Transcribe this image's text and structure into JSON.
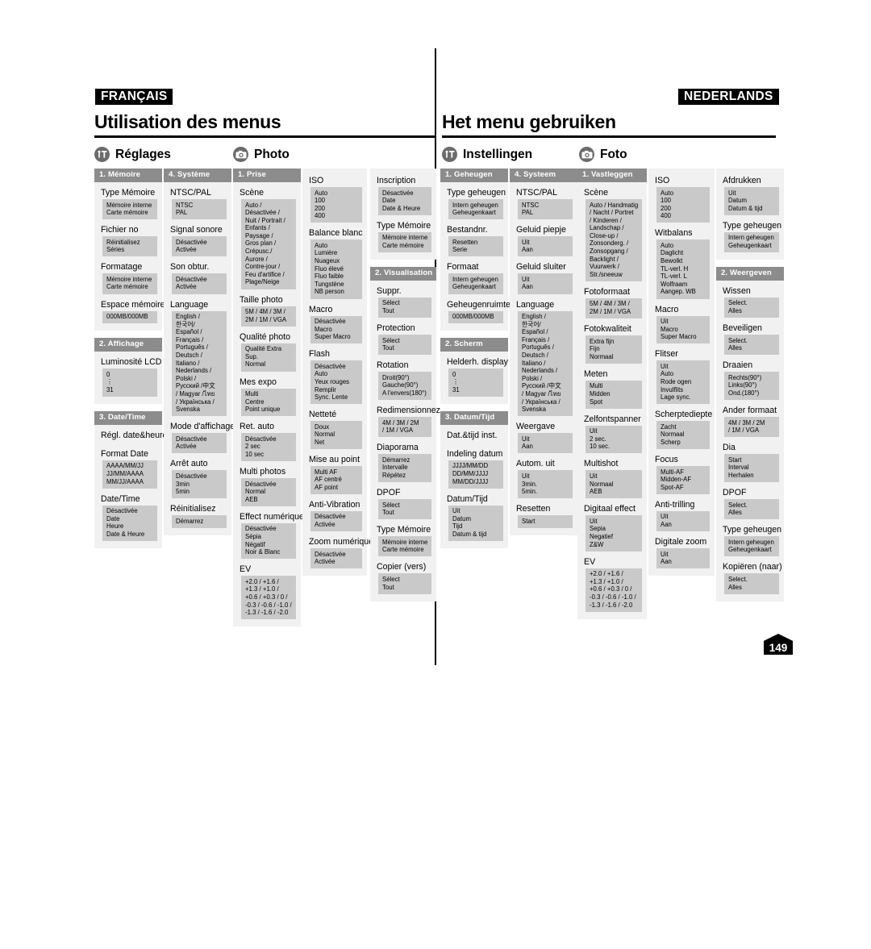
{
  "left": {
    "language_tag": "FRANÇAIS",
    "title": "Utilisation des menus",
    "sections": [
      {
        "icon": "settings-icon",
        "label": "Réglages"
      },
      {
        "icon": "camera-icon",
        "label": "Photo"
      }
    ],
    "columns": [
      {
        "groups": [
          {
            "head": "1. Mémoire",
            "items": [
              {
                "label": "Type Mémoire",
                "options": [
                  "Mémoire interne",
                  "Carte mémoire"
                ]
              },
              {
                "label": "Fichier no",
                "options": [
                  "Réinitialisez",
                  "Séries"
                ]
              },
              {
                "label": "Formatage",
                "options": [
                  "Mémoire interne",
                  "Carte mémoire"
                ]
              },
              {
                "label": "Espace mémoire",
                "options": [
                  "000MB/000MB"
                ]
              }
            ]
          },
          {
            "head": "2. Affichage",
            "items": [
              {
                "label": "Luminosité LCD",
                "options": [
                  "0",
                  "⋮",
                  "31"
                ]
              }
            ]
          },
          {
            "head": "3. Date/Time",
            "items": [
              {
                "label": "Régl. date&heure",
                "options": []
              },
              {
                "label": "Format Date",
                "options": [
                  "AAAA/MM/JJ",
                  "JJ/MM/AAAA",
                  "MM/JJ/AAAA"
                ]
              },
              {
                "label": "Date/Time",
                "options": [
                  "Désactivée",
                  "Date",
                  "Heure",
                  "Date & Heure"
                ]
              }
            ]
          }
        ]
      },
      {
        "groups": [
          {
            "head": "4. Système",
            "items": [
              {
                "label": "NTSC/PAL",
                "options": [
                  "NTSC",
                  "PAL"
                ]
              },
              {
                "label": "Signal sonore",
                "options": [
                  "Désactivée",
                  "Activée"
                ]
              },
              {
                "label": "Son obtur.",
                "options": [
                  "Désactivée",
                  "Activée"
                ]
              },
              {
                "label": "Language",
                "options": [
                  "English /",
                  "한국어/",
                  "Español /",
                  "Français /",
                  "Português /",
                  "Deutsch /",
                  "Italiano /",
                  "Nederlands /",
                  "Polski /",
                  "Русский /中文",
                  "/ Magyar /ไทย",
                  "/ Українська /",
                  "Svenska"
                ]
              },
              {
                "label": "Mode d'affichage",
                "options": [
                  "Désactivée",
                  "Activée"
                ]
              },
              {
                "label": "Arrêt auto",
                "options": [
                  "Désactivée",
                  "3min",
                  "5min"
                ]
              },
              {
                "label": "Réinitialisez",
                "options": [
                  "Démarrez"
                ]
              }
            ]
          }
        ]
      },
      {
        "groups": [
          {
            "head": "1. Prise",
            "items": [
              {
                "label": "Scène",
                "options": [
                  "Auto /",
                  "Désactivée /",
                  "Nuit / Portrait /",
                  "Enfants /",
                  "Paysage /",
                  "Gros plan /",
                  "Crépusc./",
                  "Aurore /",
                  "Contre-jour /",
                  "Feu d'artifice /",
                  "Plage/Neige"
                ]
              },
              {
                "label": "Taille photo",
                "options": [
                  "5M / 4M / 3M /",
                  "2M / 1M / VGA"
                ]
              },
              {
                "label": "Qualité photo",
                "options": [
                  "Qualité Extra",
                  "Sup.",
                  "Normal"
                ]
              },
              {
                "label": "Mes expo",
                "options": [
                  "Multi",
                  "Centre",
                  "Point unique"
                ]
              },
              {
                "label": "Ret. auto",
                "options": [
                  "Désactivée",
                  "2 sec",
                  "10 sec"
                ]
              },
              {
                "label": "Multi photos",
                "options": [
                  "Désactivée",
                  "Normal",
                  "AEB"
                ]
              },
              {
                "label": "Effect numérique",
                "options": [
                  "Désactivée",
                  "Sépia",
                  "Négatif",
                  "Noir & Blanc"
                ]
              },
              {
                "label": "EV",
                "options": [
                  "+2.0 / +1.6 /",
                  "+1.3 / +1.0 /",
                  "+0.6 / +0.3 / 0 /",
                  "-0.3 / -0.6 / -1.0 /",
                  "-1.3 / -1.6 / -2.0"
                ]
              }
            ]
          }
        ]
      },
      {
        "groups": [
          {
            "head": "",
            "items": [
              {
                "label": "ISO",
                "options": [
                  "Auto",
                  "100",
                  "200",
                  "400"
                ]
              },
              {
                "label": "Balance blanc",
                "options": [
                  "Auto",
                  "Lumière",
                  "Nuageux",
                  "Fluo élevé",
                  "Fluo faible",
                  "Tungstène",
                  "NB person"
                ]
              },
              {
                "label": "Macro",
                "options": [
                  "Désactivée",
                  "Macro",
                  "Super Macro"
                ]
              },
              {
                "label": "Flash",
                "options": [
                  "Désactivée",
                  "Auto",
                  "Yeux rouges",
                  "Remplir",
                  "Sync. Lente"
                ]
              },
              {
                "label": "Netteté",
                "options": [
                  "Doux",
                  "Normal",
                  "Net"
                ]
              },
              {
                "label": "Mise au point",
                "options": [
                  "Multi AF",
                  "AF centré",
                  "AF point"
                ]
              },
              {
                "label": "Anti-Vibration",
                "options": [
                  "Désactivée",
                  "Activée"
                ]
              },
              {
                "label": "Zoom numérique",
                "options": [
                  "Désactivée",
                  "Activée"
                ]
              }
            ]
          }
        ]
      },
      {
        "groups": [
          {
            "head": "",
            "items": [
              {
                "label": "Inscription",
                "options": [
                  "Désactivée",
                  "Date",
                  "Date & Heure"
                ]
              },
              {
                "label": "Type Mémoire",
                "options": [
                  "Mémoire interne",
                  "Carte mémoire"
                ]
              }
            ]
          },
          {
            "head": "2. Visualisation",
            "items": [
              {
                "label": "Suppr.",
                "options": [
                  "Sélect",
                  "Tout"
                ]
              },
              {
                "label": "Protection",
                "options": [
                  "Sélect",
                  "Tout"
                ]
              },
              {
                "label": "Rotation",
                "options": [
                  "Droit(90°)",
                  "Gauche(90°)",
                  "A l'envers(180°)"
                ]
              },
              {
                "label": "Redimensionnez",
                "options": [
                  "4M / 3M / 2M",
                  "/ 1M / VGA"
                ]
              },
              {
                "label": "Diaporama",
                "options": [
                  "Démarrez",
                  "Intervalle",
                  "Répétez"
                ]
              },
              {
                "label": "DPOF",
                "options": [
                  "Sélect",
                  "Tout"
                ]
              },
              {
                "label": "Type Mémoire",
                "options": [
                  "Mémoire interne",
                  "Carte mémoire"
                ]
              },
              {
                "label": "Copier (vers)",
                "options": [
                  "Sélect",
                  "Tout"
                ]
              }
            ]
          }
        ]
      }
    ]
  },
  "right": {
    "language_tag": "NEDERLANDS",
    "title": "Het menu gebruiken",
    "sections": [
      {
        "icon": "settings-icon",
        "label": "Instellingen"
      },
      {
        "icon": "camera-icon",
        "label": "Foto"
      }
    ],
    "columns": [
      {
        "groups": [
          {
            "head": "1. Geheugen",
            "items": [
              {
                "label": "Type geheugen",
                "options": [
                  "Intern geheugen",
                  "Geheugenkaart"
                ]
              },
              {
                "label": "Bestandnr.",
                "options": [
                  "Resetten",
                  "Serie"
                ]
              },
              {
                "label": "Formaat",
                "options": [
                  "Intern geheugen",
                  "Geheugenkaart"
                ]
              },
              {
                "label": "Geheugenruimte",
                "options": [
                  "000MB/000MB"
                ]
              }
            ]
          },
          {
            "head": "2. Scherm",
            "items": [
              {
                "label": "Helderh. display",
                "options": [
                  "0",
                  "⋮",
                  "31"
                ]
              }
            ]
          },
          {
            "head": "3. Datum/Tijd",
            "items": [
              {
                "label": "Dat.&tijd inst.",
                "options": []
              },
              {
                "label": "Indeling datum",
                "options": [
                  "JJJJ/MM/DD",
                  "DD/MM/JJJJ",
                  "MM/DD/JJJJ"
                ]
              },
              {
                "label": "Datum/Tijd",
                "options": [
                  "Uit",
                  "Datum",
                  "Tijd",
                  "Datum & tijd"
                ]
              }
            ]
          }
        ]
      },
      {
        "groups": [
          {
            "head": "4. Systeem",
            "items": [
              {
                "label": "NTSC/PAL",
                "options": [
                  "NTSC",
                  "PAL"
                ]
              },
              {
                "label": "Geluid piepje",
                "options": [
                  "Uit",
                  "Aan"
                ]
              },
              {
                "label": "Geluid sluiter",
                "options": [
                  "Uit",
                  "Aan"
                ]
              },
              {
                "label": "Language",
                "options": [
                  "English /",
                  "한국어/",
                  "Español /",
                  "Français /",
                  "Português /",
                  "Deutsch /",
                  "Italiano /",
                  "Nederlands /",
                  "Polski /",
                  "Русский /中文",
                  "/ Magyar /ไทย",
                  "/ Українська /",
                  "Svenska"
                ]
              },
              {
                "label": "Weergave",
                "options": [
                  "Uit",
                  "Aan"
                ]
              },
              {
                "label": "Autom. uit",
                "options": [
                  "Uit",
                  "3min.",
                  "5min."
                ]
              },
              {
                "label": "Resetten",
                "options": [
                  "Start"
                ]
              }
            ]
          }
        ]
      },
      {
        "groups": [
          {
            "head": "1. Vastleggen",
            "items": [
              {
                "label": "Scène",
                "options": [
                  "Auto / Handmatig",
                  "/ Nacht / Portret",
                  "/ Kinderen /",
                  "Landschap /",
                  "Close-up /",
                  "Zonsonderg. /",
                  "Zonsopgang /",
                  "Backlight /",
                  "Vuurwerk /",
                  "Str./sneeuw"
                ]
              },
              {
                "label": "Fotoformaat",
                "options": [
                  "5M / 4M / 3M /",
                  "2M / 1M / VGA"
                ]
              },
              {
                "label": "Fotokwaliteit",
                "options": [
                  "Extra fijn",
                  "Fijn",
                  "Normaal"
                ]
              },
              {
                "label": "Meten",
                "options": [
                  "Multi",
                  "Midden",
                  "Spot"
                ]
              },
              {
                "label": "Zelfontspanner",
                "options": [
                  "Uit",
                  "2 sec.",
                  "10 sec."
                ]
              },
              {
                "label": "Multishot",
                "options": [
                  "Uit",
                  "Normaal",
                  "AEB"
                ]
              },
              {
                "label": "Digitaal effect",
                "options": [
                  "Uit",
                  "Sepia",
                  "Negatief",
                  "Z&W"
                ]
              },
              {
                "label": "EV",
                "options": [
                  "+2.0 / +1.6 /",
                  "+1.3 / +1.0 /",
                  "+0.6 / +0.3 / 0 /",
                  "-0.3 / -0.6 / -1.0 /",
                  "-1.3 / -1.6 / -2.0"
                ]
              }
            ]
          }
        ]
      },
      {
        "groups": [
          {
            "head": "",
            "items": [
              {
                "label": "ISO",
                "options": [
                  "Auto",
                  "100",
                  "200",
                  "400"
                ]
              },
              {
                "label": "Witbalans",
                "options": [
                  "Auto",
                  "Daglicht",
                  "Bewolkt",
                  "TL-verl. H",
                  "TL-verl. L",
                  "Wolfraam",
                  "Aangep. WB"
                ]
              },
              {
                "label": "Macro",
                "options": [
                  "Uit",
                  "Macro",
                  "Super Macro"
                ]
              },
              {
                "label": "Flitser",
                "options": [
                  "Uit",
                  "Auto",
                  "Rode ogen",
                  "Invulflits",
                  "Lage sync."
                ]
              },
              {
                "label": "Scherptediepte",
                "options": [
                  "Zacht",
                  "Normaal",
                  "Scherp"
                ]
              },
              {
                "label": "Focus",
                "options": [
                  "Multi-AF",
                  "Midden-AF",
                  "Spot-AF"
                ]
              },
              {
                "label": "Anti-trilling",
                "options": [
                  "Uit",
                  "Aan"
                ]
              },
              {
                "label": "Digitale zoom",
                "options": [
                  "Uit",
                  "Aan"
                ]
              }
            ]
          }
        ]
      },
      {
        "groups": [
          {
            "head": "",
            "items": [
              {
                "label": "Afdrukken",
                "options": [
                  "Uit",
                  "Datum",
                  "Datum & tijd"
                ]
              },
              {
                "label": "Type geheugen",
                "options": [
                  "Intern geheugen",
                  "Geheugenkaart"
                ]
              }
            ]
          },
          {
            "head": "2. Weergeven",
            "items": [
              {
                "label": "Wissen",
                "options": [
                  "Select.",
                  "Alles"
                ]
              },
              {
                "label": "Beveiligen",
                "options": [
                  "Select.",
                  "Alles"
                ]
              },
              {
                "label": "Draaien",
                "options": [
                  "Rechts(90°)",
                  "Links(90°)",
                  "Ond.(180°)"
                ]
              },
              {
                "label": "Ander formaat",
                "options": [
                  "4M / 3M / 2M",
                  "/ 1M / VGA"
                ]
              },
              {
                "label": "Dia",
                "options": [
                  "Start",
                  "Interval",
                  "Herhalen"
                ]
              },
              {
                "label": "DPOF",
                "options": [
                  "Select.",
                  "Alles"
                ]
              },
              {
                "label": "Type geheugen",
                "options": [
                  "Intern geheugen",
                  "Geheugenkaart"
                ]
              },
              {
                "label": "Kopiëren (naar)",
                "options": [
                  "Select.",
                  "Alles"
                ]
              }
            ]
          }
        ]
      }
    ]
  },
  "page_number": "149"
}
